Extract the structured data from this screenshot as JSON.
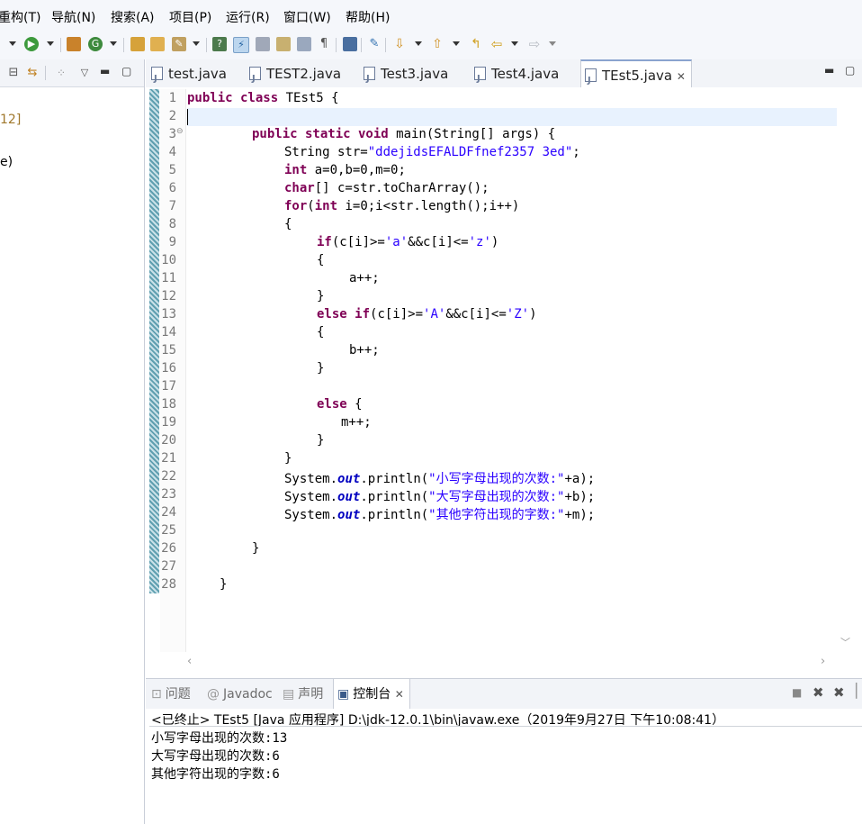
{
  "menu": [
    "重构(T)",
    "导航(N)",
    "搜索(A)",
    "项目(P)",
    "运行(R)",
    "窗口(W)",
    "帮助(H)"
  ],
  "left_panel": {
    "partial_text_1": "12]",
    "partial_text_2": "e)"
  },
  "editor_tabs": [
    {
      "label": "test.java",
      "active": false
    },
    {
      "label": "TEST2.java",
      "active": false
    },
    {
      "label": "Test3.java",
      "active": false
    },
    {
      "label": "Test4.java",
      "active": false
    },
    {
      "label": "TEst5.java",
      "active": true
    }
  ],
  "code": {
    "line_numbers": [
      "1",
      "2",
      "3",
      "4",
      "5",
      "6",
      "7",
      "8",
      "9",
      "10",
      "11",
      "12",
      "13",
      "14",
      "15",
      "16",
      "17",
      "18",
      "19",
      "20",
      "21",
      "22",
      "23",
      "24",
      "25",
      "26",
      "27",
      "28"
    ],
    "l1_kw": "public class",
    "l1_rest": " TEst5 {",
    "l3_kw": "public static void",
    "l3_rest": " main(String[] args) {",
    "l4_a": "String str=",
    "l4_str": "\"ddejidsEFALDFfnef2357 3ed\"",
    "l4_b": ";",
    "l5_kw": "int",
    "l5_rest": " a=0,b=0,m=0;",
    "l6_kw": "char",
    "l6_rest": "[] c=str.toCharArray();",
    "l7_kw1": "for",
    "l7_a": "(",
    "l7_kw2": "int",
    "l7_rest": " i=0;i<str.length();i++)",
    "l8": "{",
    "l9_kw": "if",
    "l9_a": "(c[i]>=",
    "l9_s1": "'a'",
    "l9_b": "&&c[i]<=",
    "l9_s2": "'z'",
    "l9_c": ")",
    "l10": "{",
    "l11": "a++;",
    "l12": "}",
    "l13_kw": "else if",
    "l13_a": "(c[i]>=",
    "l13_s1": "'A'",
    "l13_b": "&&c[i]<=",
    "l13_s2": "'Z'",
    "l13_c": ")",
    "l14": "{",
    "l15": "b++;",
    "l16": "}",
    "l18_kw": "else",
    "l18_rest": " {",
    "l19": "m++;",
    "l20": "}",
    "l21": "}",
    "l22_a": "System.",
    "l22_f": "out",
    "l22_b": ".println(",
    "l22_s": "\"小写字母出现的次数:\"",
    "l22_c": "+a);",
    "l23_a": "System.",
    "l23_f": "out",
    "l23_b": ".println(",
    "l23_s": "\"大写字母出现的次数:\"",
    "l23_c": "+b);",
    "l24_a": "System.",
    "l24_f": "out",
    "l24_b": ".println(",
    "l24_s": "\"其他字符出现的字数:\"",
    "l24_c": "+m);",
    "l26": "}",
    "l28": "}"
  },
  "bottom_tabs": [
    {
      "label": "问题",
      "active": false
    },
    {
      "label": "Javadoc",
      "active": false
    },
    {
      "label": "声明",
      "active": false
    },
    {
      "label": "控制台",
      "active": true
    }
  ],
  "console": {
    "header": "<已终止> TEst5 [Java 应用程序] D:\\jdk-12.0.1\\bin\\javaw.exe（2019年9月27日 下午10:08:41）",
    "lines": [
      "小写字母出现的次数:13",
      "大写字母出现的次数:6",
      "其他字符出现的字数:6"
    ]
  },
  "colors": {
    "keyword": "#7f0055",
    "string": "#2a00ff",
    "field": "#0000c0",
    "current_line": "#e8f2fe"
  }
}
